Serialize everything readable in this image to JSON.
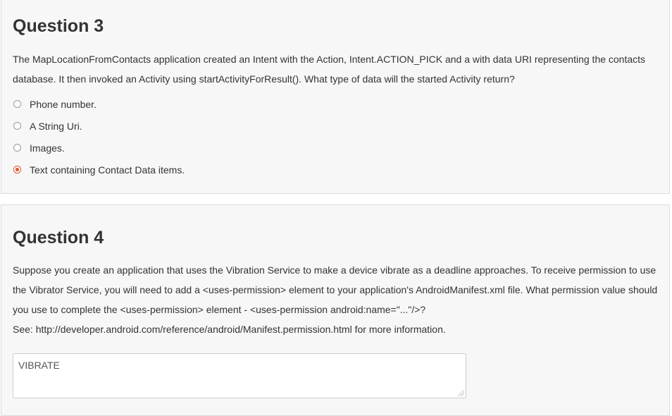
{
  "q3": {
    "title": "Question 3",
    "text": "The MapLocationFromContacts application created an Intent with the Action, Intent.ACTION_PICK and a with data URI representing the contacts database. It then invoked an Activity using startActivityForResult(). What type of data will the started Activity return?",
    "options": [
      {
        "label": "Phone number.",
        "selected": false
      },
      {
        "label": "A String Uri.",
        "selected": false
      },
      {
        "label": "Images.",
        "selected": false
      },
      {
        "label": "Text containing Contact Data items.",
        "selected": true
      }
    ],
    "accent_color": "#d9532c"
  },
  "q4": {
    "title": "Question 4",
    "text": "Suppose you create an application that uses the Vibration Service to make a device vibrate as a deadline approaches. To receive permission to use the Vibrator Service, you will need to add a <uses-permission> element to your application's AndroidManifest.xml file. What permission value should you use to complete the <uses-permission> element - <uses-permission android:name=\"...\"/>?",
    "see_text": "See: http://developer.android.com/reference/android/Manifest.permission.html for more information.",
    "answer_value": "VIBRATE"
  }
}
